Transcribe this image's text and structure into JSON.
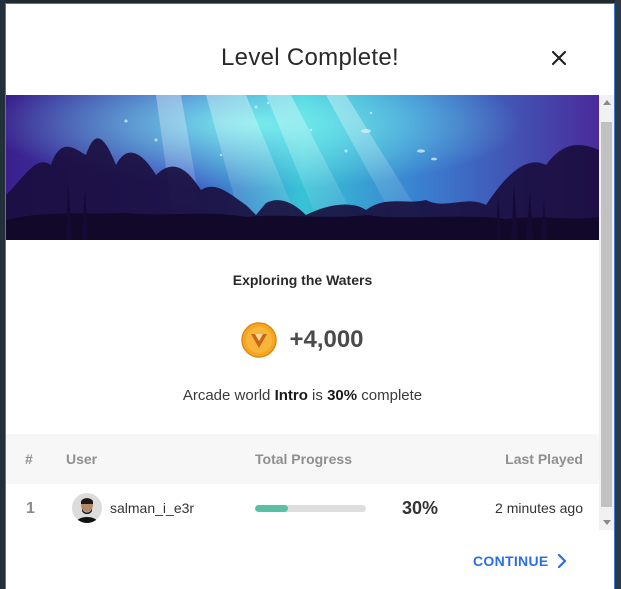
{
  "modal": {
    "title": "Level Complete!"
  },
  "level": {
    "name": "Exploring the Waters",
    "reward": "+4,000"
  },
  "progress": {
    "prefix": "Arcade world ",
    "world": "Intro",
    "middle": " is ",
    "percent": "30%",
    "suffix": " complete"
  },
  "table": {
    "headers": {
      "rank": "#",
      "user": "User",
      "total_progress": "Total Progress",
      "last_played": "Last Played"
    },
    "rows": [
      {
        "rank": "1",
        "username": "salman_i_e3r",
        "progress_fraction": 0.3,
        "percent": "30%",
        "last_played": "2 minutes ago"
      }
    ]
  },
  "footer": {
    "continue_label": "CONTINUE"
  },
  "colors": {
    "accent": "#2a6ee6",
    "progress_fill": "#5ac0a3",
    "coin": "#f5a623"
  }
}
